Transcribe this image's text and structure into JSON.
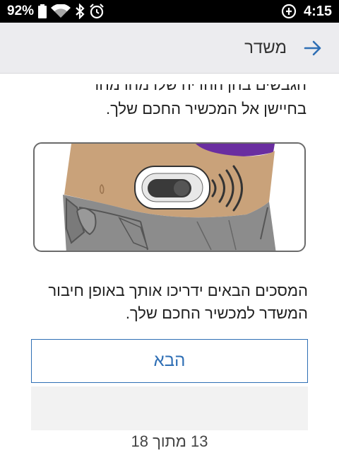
{
  "status_bar": {
    "battery_percent": "92%",
    "time": "4:15",
    "icons": [
      "battery-icon",
      "wifi-icon",
      "bluetooth-icon",
      "alarm-icon",
      "data-saver-icon"
    ]
  },
  "app_bar": {
    "title": "משדר",
    "back_icon": "arrow-right-icon"
  },
  "content": {
    "cut_line": "הגבשים בחן ההדיה שלו מחו מחו",
    "intro_text": "בחיישן אל המכשיר החכם שלך.",
    "illustration": "transmitter-on-abdomen-illustration",
    "body_text": "המסכים הבאים ידריכו אותך באופן חיבור המשדר למכשיר החכם שלך.",
    "next_button_label": "הבא",
    "page_counter": "13 מתוך 18"
  },
  "colors": {
    "accent": "#2f6fb5",
    "app_bar_bg": "#ececef",
    "skin": "#c9a27a",
    "shirt": "#6a2ea0",
    "jeans": "#8c8c8c"
  }
}
